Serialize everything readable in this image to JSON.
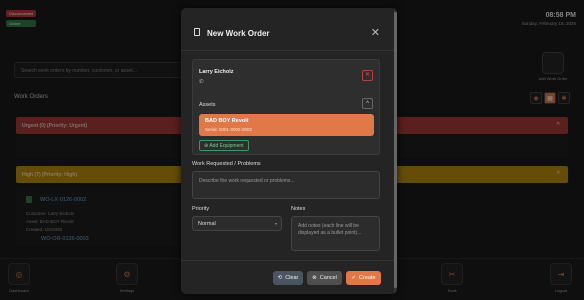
{
  "header": {
    "badges": [
      "Disconnected",
      "Online"
    ],
    "time": "08:58 PM",
    "date": "Sunday, February 15, 2026"
  },
  "search": {
    "placeholder": "Search work orders by number, customer, or asset..."
  },
  "add_work_order_label": "Add Work Order",
  "section_title": "Work Orders",
  "groups": {
    "urgent": "Urgent (0) (Priority: Urgent)",
    "high": "High (7) (Priority: High)"
  },
  "work_order": {
    "id": "WO-LX-0126-0002",
    "customer": "Customer: Larry Eicholz",
    "asset": "Asset: BAD BOY Revolt",
    "created": "Created: 1/5/2026",
    "next_id": "WO-OR-0126-0003"
  },
  "bottom_nav": [
    "Dashboard",
    "Settings",
    "Tools",
    "Logout"
  ],
  "modal": {
    "title": "New Work Order",
    "customer_name": "Larry Eicholz",
    "assets_label": "Assets",
    "asset_name": "BAD BOY Revolt",
    "asset_serial": "Serial: 0001-0002-0002",
    "add_equipment": "Add Equipment",
    "work_label": "Work Requested / Problems",
    "work_placeholder": "Describe the work requested or problems...",
    "priority_label": "Priority",
    "priority_value": "Normal",
    "notes_label": "Notes",
    "notes_placeholder": "Add notes (each line will be displayed as a bullet point)...",
    "clear": "Clear",
    "cancel": "Cancel",
    "create": "Create"
  },
  "colors": {
    "accent": "#e07848",
    "urgent": "#a53a3a",
    "high": "#b88a10"
  }
}
